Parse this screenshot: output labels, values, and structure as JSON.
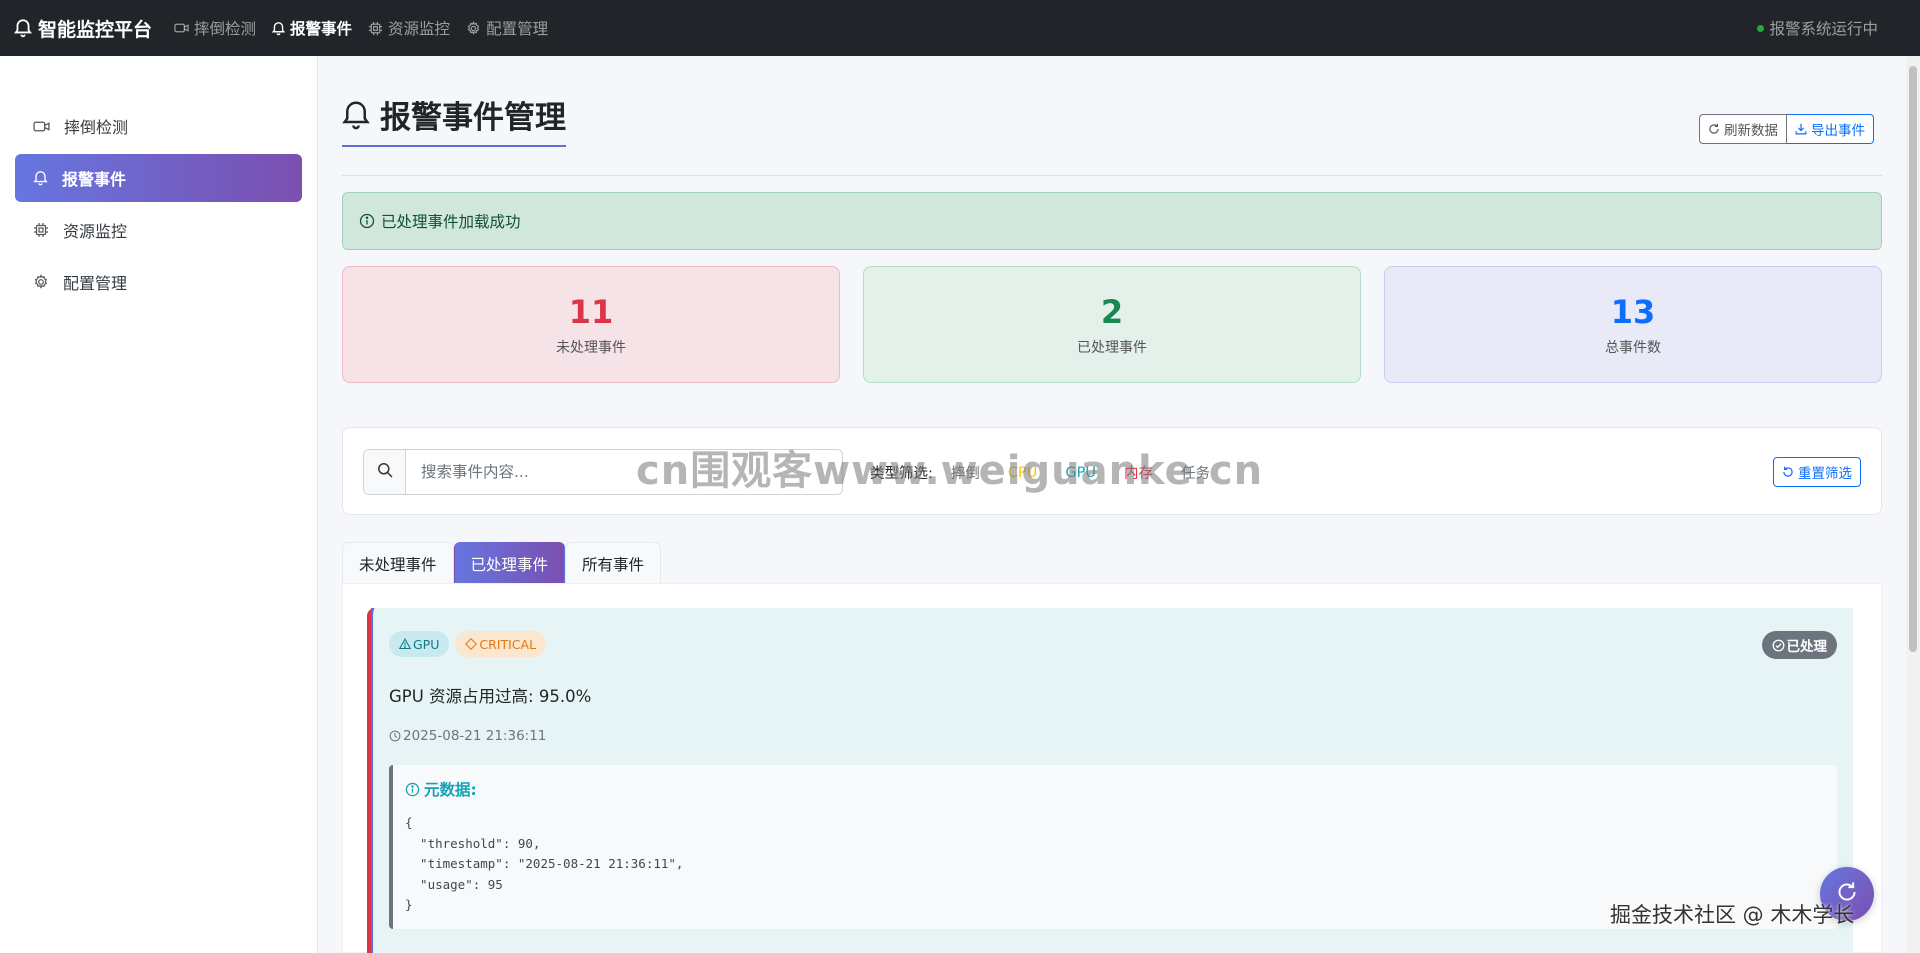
{
  "navbar": {
    "brand": "智能监控平台",
    "links": [
      {
        "label": "摔倒检测",
        "icon": "camera-video-icon"
      },
      {
        "label": "报警事件",
        "icon": "bell-icon",
        "active": true
      },
      {
        "label": "资源监控",
        "icon": "cpu-icon"
      },
      {
        "label": "配置管理",
        "icon": "gear-icon"
      }
    ],
    "status": "报警系统运行中",
    "status_color": "#28a745"
  },
  "sidebar": {
    "items": [
      {
        "label": "摔倒检测",
        "icon": "camera-video-icon"
      },
      {
        "label": "报警事件",
        "icon": "bell-icon",
        "active": true
      },
      {
        "label": "资源监控",
        "icon": "cpu-icon"
      },
      {
        "label": "配置管理",
        "icon": "gear-icon"
      }
    ]
  },
  "page": {
    "title": "报警事件管理",
    "refresh_label": "刷新数据",
    "export_label": "导出事件"
  },
  "alert": {
    "message": "已处理事件加载成功"
  },
  "stats": {
    "unprocessed": {
      "value": "11",
      "label": "未处理事件"
    },
    "processed": {
      "value": "2",
      "label": "已处理事件"
    },
    "total": {
      "value": "13",
      "label": "总事件数"
    }
  },
  "filter": {
    "search_placeholder": "搜索事件内容...",
    "type_label": "类型筛选:",
    "types": [
      {
        "label": "摔倒",
        "color": "#6c757d"
      },
      {
        "label": "CPU",
        "color": "#ffc107"
      },
      {
        "label": "GPU",
        "color": "#17a2b8"
      },
      {
        "label": "内存",
        "color": "#dc3545"
      },
      {
        "label": "任务",
        "color": "#6c757d"
      }
    ],
    "reset_label": "重置筛选"
  },
  "tabs": [
    {
      "label": "未处理事件"
    },
    {
      "label": "已处理事件",
      "active": true
    },
    {
      "label": "所有事件"
    }
  ],
  "event": {
    "type_badge": "GPU",
    "level_badge": "CRITICAL",
    "status": "已处理",
    "title": "GPU 资源占用过高: 95.0%",
    "time": "2025-08-21 21:36:11",
    "meta_title": "元数据:",
    "meta_json": "{\n  \"threshold\": 90,\n  \"timestamp\": \"2025-08-21 21:36:11\",\n  \"usage\": 95\n}"
  },
  "watermarks": {
    "center": "cn围观客www.weiguanke.cn",
    "corner": "掘金技术社区 @ 木木学长"
  },
  "colors": {
    "accent_gradient_start": "#6676e0",
    "accent_gradient_end": "#7b4fb0",
    "danger": "#dc3545",
    "success": "#198754",
    "primary": "#0d6efd",
    "info": "#17a2b8"
  }
}
